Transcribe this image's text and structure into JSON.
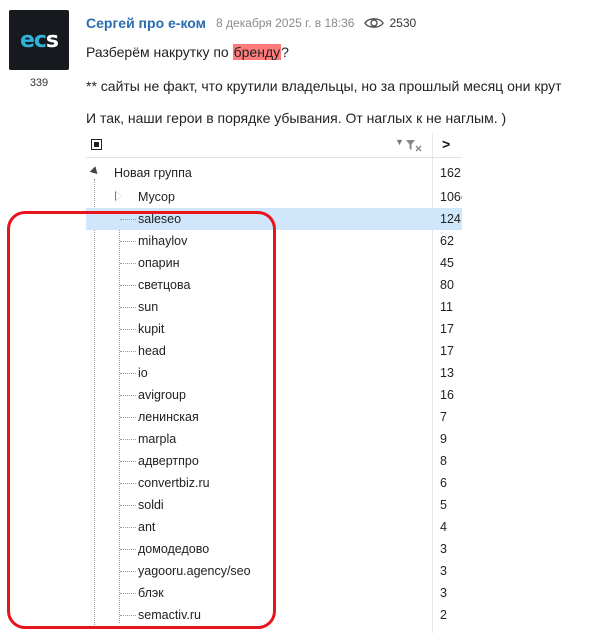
{
  "post": {
    "avatar_text_a": "e",
    "avatar_text_b": "c",
    "avatar_text_c": "s",
    "rating": "339",
    "author": "Сергей про е-ком",
    "date": "8 декабря 2025 г. в 18:36",
    "views": "2530",
    "line1_before": "Разберём накрутку по ",
    "line1_highlight": "бренду",
    "line1_after": "?",
    "line2": "** сайты не факт, что крутили владельцы, но за прошлый месяц они крут",
    "line3": "И так, наши герои в порядке убывания. От наглых к не наглым. )"
  },
  "table": {
    "header_gt": ">",
    "group": {
      "label": "Новая группа",
      "value": "162"
    },
    "subgroup": {
      "label": "Мусор",
      "value": "106("
    },
    "rows": [
      {
        "label": "saleseo",
        "value": "124",
        "selected": true
      },
      {
        "label": "mihaylov",
        "value": "62"
      },
      {
        "label": "опарин",
        "value": "45"
      },
      {
        "label": "светцова",
        "value": "80"
      },
      {
        "label": "sun",
        "value": "11"
      },
      {
        "label": "kupit",
        "value": "17"
      },
      {
        "label": "head",
        "value": "17"
      },
      {
        "label": "io",
        "value": "13"
      },
      {
        "label": "avigroup",
        "value": "16"
      },
      {
        "label": "ленинская",
        "value": "7"
      },
      {
        "label": "marpla",
        "value": "9"
      },
      {
        "label": "адвертпро",
        "value": "8"
      },
      {
        "label": "convertbiz.ru",
        "value": "6"
      },
      {
        "label": "soldi",
        "value": "5"
      },
      {
        "label": "ant",
        "value": "4"
      },
      {
        "label": "домодедово",
        "value": "3"
      },
      {
        "label": "yagooru.agency/seo",
        "value": "3"
      },
      {
        "label": "блэк",
        "value": "3"
      },
      {
        "label": "semactiv.ru",
        "value": "2"
      }
    ]
  },
  "colors": {
    "author": "#2a6cb0",
    "highlight": "#ff7a7a",
    "selection": "#cfe6fb",
    "annotation": "#e8141c"
  },
  "icons": {
    "views": "eye-icon",
    "checkbox": "square-checkbox-icon",
    "filter": "filter-clear-icon"
  }
}
